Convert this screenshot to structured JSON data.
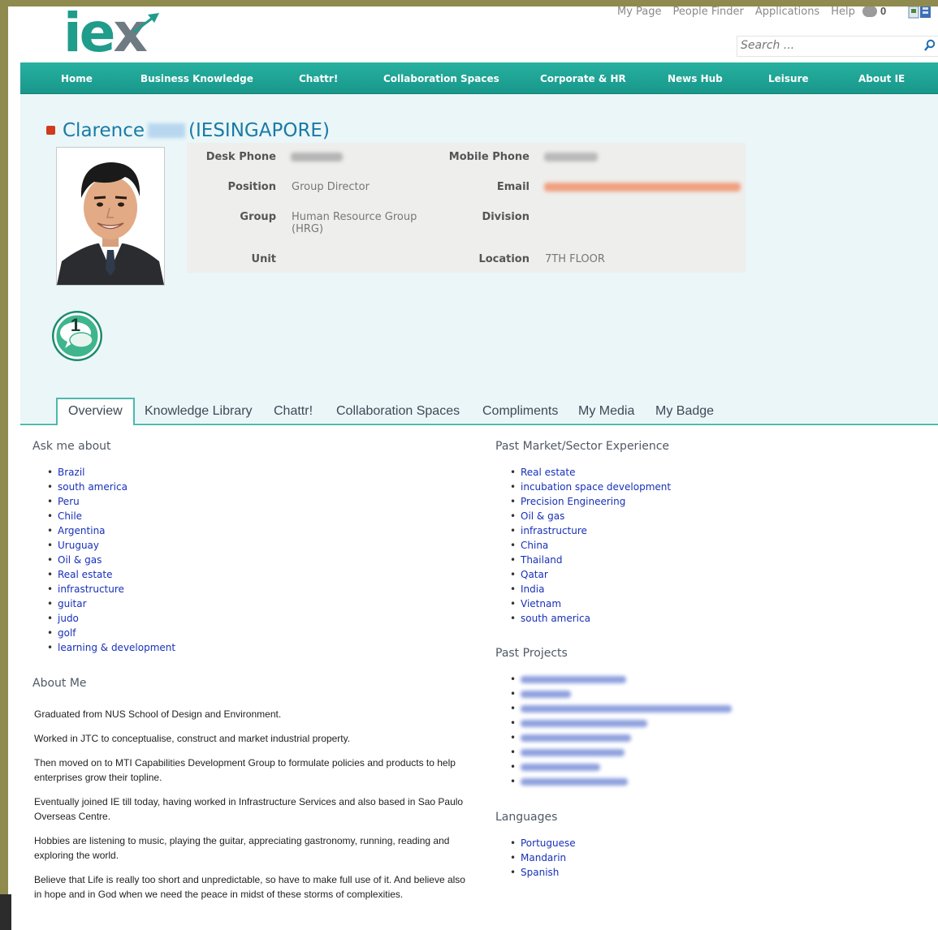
{
  "header": {
    "logo": "iex",
    "utility_links": [
      "My Page",
      "People Finder",
      "Applications",
      "Help"
    ],
    "message_count": "0",
    "search_placeholder": "Search ..."
  },
  "nav": [
    "Home",
    "Business Knowledge",
    "Chattr!",
    "Collaboration Spaces",
    "Corporate & HR",
    "News Hub",
    "Leisure",
    "About IE"
  ],
  "profile": {
    "first_name": "Clarence",
    "org": "(IESINGAPORE)",
    "labels": {
      "desk_phone": "Desk Phone",
      "position": "Position",
      "group": "Group",
      "unit": "Unit",
      "mobile_phone": "Mobile Phone",
      "email": "Email",
      "division": "Division",
      "location": "Location"
    },
    "position": "Group Director",
    "group_line1": "Human Resource Group",
    "group_line2": "(HRG)",
    "location": "7TH FLOOR",
    "badge_count": "1"
  },
  "tabs": [
    "Overview",
    "Knowledge Library",
    "Chattr!",
    "Collaboration Spaces",
    "Compliments",
    "My Media",
    "My Badge"
  ],
  "ask_me_about": {
    "title": "Ask me about",
    "items": [
      "Brazil",
      "south america",
      "Peru",
      "Chile",
      "Argentina",
      "Uruguay",
      "Oil & gas",
      "Real estate",
      "infrastructure",
      "guitar",
      "judo",
      "golf",
      "learning & development"
    ]
  },
  "about_me": {
    "title": "About Me",
    "paragraphs": [
      "Graduated from NUS School of Design and Environment.",
      "Worked in JTC to conceptualise, construct and market industrial property.",
      "Then moved on to MTI Capabilities Development Group to formulate policies and products to help enterprises grow their topline.",
      "Eventually joined IE till today, having worked in Infrastructure Services and also based in Sao Paulo Overseas Centre.",
      "Hobbies are listening to music, playing the guitar, appreciating gastronomy, running, reading and exploring the world.",
      "Believe that Life is really too short and unpredictable, so have to make full use of it. And believe also in hope and in God when we need the peace in midst of these storms of complexities."
    ]
  },
  "past_experience": {
    "title": "Past Market/Sector Experience",
    "items": [
      "Real estate",
      "incubation space development",
      "Precision Engineering",
      "Oil & gas",
      "infrastructure",
      "China",
      "Thailand",
      "Qatar",
      "India",
      "Vietnam",
      "south america"
    ]
  },
  "past_projects": {
    "title": "Past Projects",
    "count": 8
  },
  "languages": {
    "title": "Languages",
    "items": [
      "Portuguese",
      "Mandarin",
      "Spanish"
    ]
  }
}
